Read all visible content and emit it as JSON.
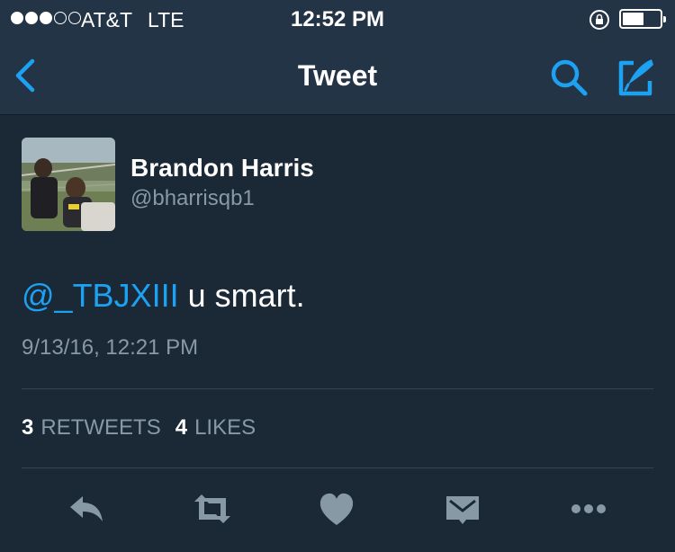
{
  "status_bar": {
    "carrier": "AT&T",
    "network": "LTE",
    "time": "12:52 PM",
    "signal_bars_filled": 3,
    "signal_bars_total": 5,
    "battery_level": 0.62
  },
  "nav": {
    "title": "Tweet",
    "back_icon": "chevron-left-icon",
    "search_icon": "search-icon",
    "compose_icon": "compose-tweet-icon"
  },
  "tweet": {
    "display_name": "Brandon Harris",
    "handle": "@bharrisqb1",
    "mention": "@_TBJXIII",
    "text": " u smart.",
    "timestamp": "9/13/16, 12:21 PM",
    "retweets_count": "3",
    "retweets_label": "RETWEETS",
    "likes_count": "4",
    "likes_label": "LIKES"
  },
  "actions": [
    "reply-icon",
    "retweet-icon",
    "like-icon",
    "direct-message-icon",
    "more-icon"
  ],
  "colors": {
    "background": "#1b2836",
    "bar_background": "#243447",
    "accent": "#1da1f2",
    "muted_text": "#8899a6",
    "action_icon": "#8899a6"
  }
}
